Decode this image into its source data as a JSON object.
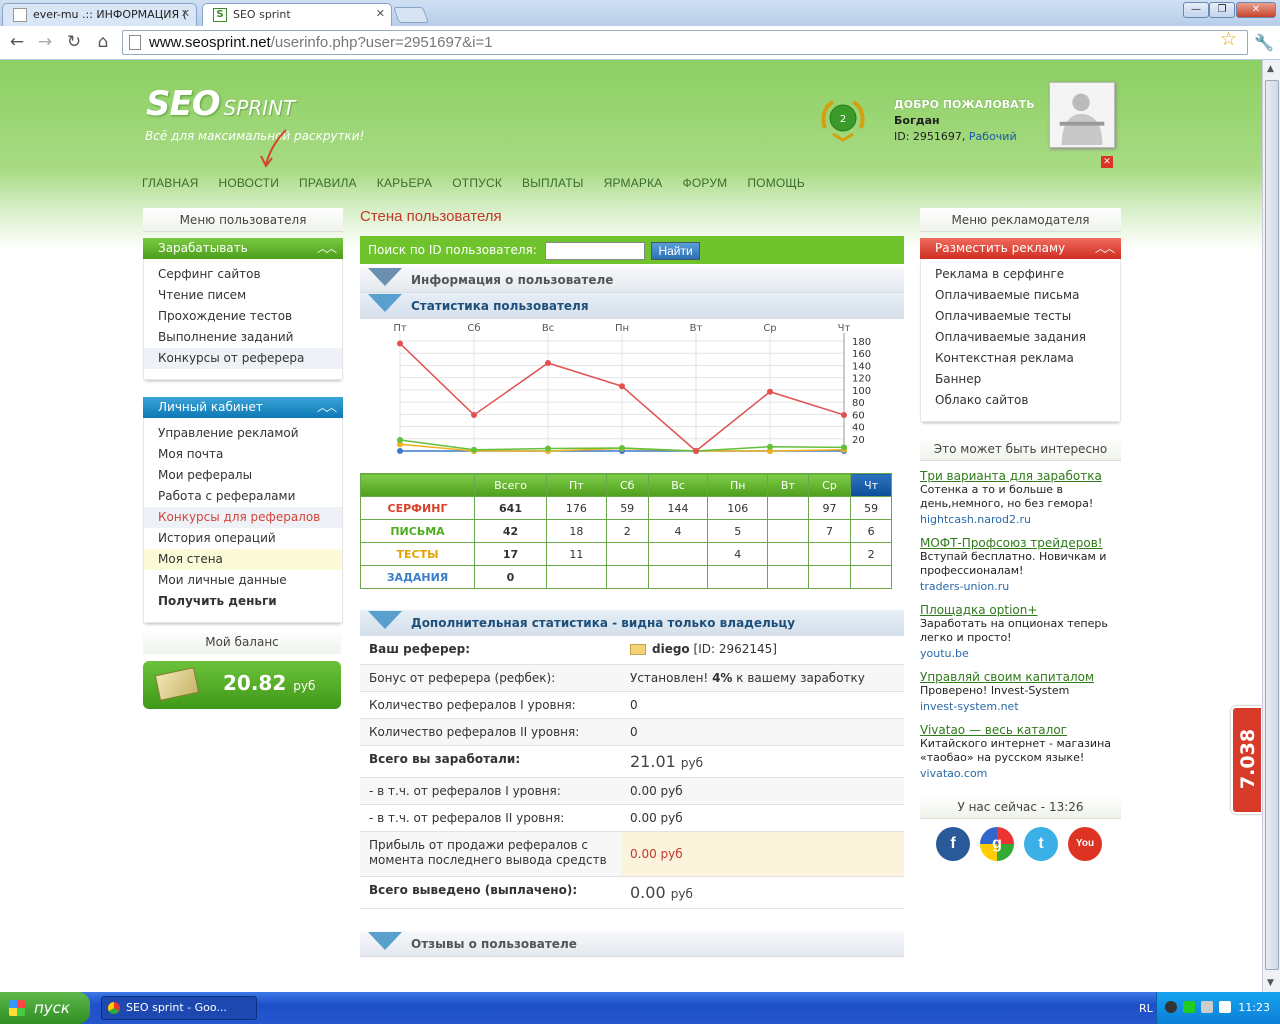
{
  "browser": {
    "tabs": [
      {
        "label": "ever-mu .:: ИНФОРМАЦИЯ ("
      },
      {
        "label": "SEO sprint"
      }
    ],
    "url_host": "www.seosprint.net",
    "url_path": "/userinfo.php?user=2951697&i=1",
    "window_buttons": {
      "minimize": "—",
      "maximize": "❐",
      "close": "✕"
    }
  },
  "header": {
    "logo_main": "SEO",
    "logo_sub": "SPRINT",
    "tagline": "Всё для максимальной раскрутки!",
    "medal_level": "2",
    "welcome_heading": "ДОБРО ПОЖАЛОВАТЬ",
    "user_name": "Богдан",
    "user_id_prefix": "ID: 2951697,",
    "user_status": "Рабочий",
    "logout_glyph": "✕"
  },
  "topnav": [
    "ГЛАВНАЯ",
    "НОВОСТИ",
    "ПРАВИЛА",
    "КАРЬЕРА",
    "ОТПУСК",
    "ВЫПЛАТЫ",
    "ЯРМАРКА",
    "ФОРУМ",
    "ПОМОЩЬ"
  ],
  "left": {
    "user_menu_title": "Меню пользователя",
    "earn": {
      "title": "Зарабатывать",
      "items": [
        "Серфинг сайтов",
        "Чтение писем",
        "Прохождение тестов",
        "Выполнение заданий",
        "Конкурсы от реферера"
      ]
    },
    "cabinet": {
      "title": "Личный кабинет",
      "items": [
        "Управление рекламой",
        "Моя почта",
        "Мои рефералы",
        "Работа с рефералами",
        "Конкурсы для рефералов",
        "История операций",
        "Моя стена",
        "Мои личные данные",
        "Получить деньги"
      ]
    },
    "balance": {
      "title": "Мой баланс",
      "amount": "20.82",
      "currency": "руб"
    }
  },
  "center": {
    "page_title": "Стена пользователя",
    "search_label": "Поиск по ID пользователя:",
    "search_value": "",
    "search_button": "Найти",
    "sect_info": "Информация о пользователе",
    "sect_stats": "Статистика пользователя",
    "sect_additional": "Дополнительная статистика - видна только владельцу",
    "sect_reviews": "Отзывы о пользователе",
    "stats_table": {
      "headers": [
        "",
        "Всего",
        "Пт",
        "Сб",
        "Вс",
        "Пн",
        "Вт",
        "Ср",
        "Чт"
      ],
      "rows": [
        {
          "label": "СЕРФИНГ",
          "cells": [
            "641",
            "176",
            "59",
            "144",
            "106",
            "",
            "97",
            "59"
          ]
        },
        {
          "label": "ПИСЬМА",
          "cells": [
            "42",
            "18",
            "2",
            "4",
            "5",
            "",
            "7",
            "6"
          ]
        },
        {
          "label": "ТЕСТЫ",
          "cells": [
            "17",
            "11",
            "",
            "",
            "4",
            "",
            "",
            "2"
          ]
        },
        {
          "label": "ЗАДАНИЯ",
          "cells": [
            "0",
            "",
            "",
            "",
            "",
            "",
            "",
            ""
          ]
        }
      ]
    },
    "additional": [
      {
        "k": "Ваш реферер:",
        "v": "diego",
        "v2": "[ID: 2962145]"
      },
      {
        "k": "Бонус от реферера (рефбек):",
        "v": "Установлен!",
        "v2": "4%",
        "v3": "к вашему заработку"
      },
      {
        "k": "Количество рефералов I уровня:",
        "v": "0"
      },
      {
        "k": "Количество рефералов II уровня:",
        "v": "0"
      },
      {
        "k": "Всего вы заработали:",
        "v": "21.01",
        "v2": "руб"
      },
      {
        "k": "- в т.ч. от рефералов I уровня:",
        "v": "0.00 руб"
      },
      {
        "k": "- в т.ч. от рефералов II уровня:",
        "v": "0.00 руб"
      },
      {
        "k": "Прибыль от продажи рефералов с момента последнего вывода средств",
        "v": "0.00 руб"
      },
      {
        "k": "Всего выведено (выплачено):",
        "v": "0.00",
        "v2": "руб"
      }
    ]
  },
  "chart_data": {
    "type": "line",
    "categories": [
      "Пт",
      "Сб",
      "Вс",
      "Пн",
      "Вт",
      "Ср",
      "Чт"
    ],
    "ylim": [
      0,
      180
    ],
    "yticks": [
      "180",
      "160",
      "140",
      "120",
      "100",
      "80",
      "60",
      "40",
      "20"
    ],
    "grid": true,
    "series": [
      {
        "values": [
          176,
          59,
          144,
          106,
          0,
          97,
          59
        ],
        "color": "#e25050"
      },
      {
        "values": [
          18,
          2,
          4,
          5,
          0,
          7,
          6
        ],
        "color": "#62c13a"
      },
      {
        "values": [
          11,
          0,
          0,
          4,
          0,
          0,
          2
        ],
        "color": "#f0b020"
      },
      {
        "values": [
          0,
          0,
          0,
          0,
          0,
          0,
          0
        ],
        "color": "#3a7ac8"
      }
    ]
  },
  "right": {
    "adv_menu_title": "Меню рекламодателя",
    "place_ad": "Разместить рекламу",
    "items": [
      "Реклама в серфинге",
      "Оплачиваемые письма",
      "Оплачиваемые тесты",
      "Оплачиваемые задания",
      "Контекстная реклама",
      "Баннер",
      "Облако сайтов"
    ],
    "interesting_title": "Это может быть интересно",
    "ads": [
      {
        "title": "Три варианта для заработка",
        "desc": "Сотенка а то и больше в день,немного, но без гемора!",
        "url": "hightcash.narod2.ru"
      },
      {
        "title": "МОФТ-Профсоюз трейдеров!",
        "desc": "Вступай бесплатно. Новичкам и профессионалам!",
        "url": "traders-union.ru"
      },
      {
        "title": "Площадка option+",
        "desc": "Заработать на опционах теперь легко и просто!",
        "url": "youtu.be"
      },
      {
        "title": "Управляй своим капиталом",
        "desc": "Проверено! Invest-System",
        "url": "invest-system.net"
      },
      {
        "title": "Vivatao — весь каталог",
        "desc": "Китайского интернет - магазина «таобао» на русском языке!",
        "url": "vivatao.com"
      }
    ],
    "now_title": "У нас сейчас - 13:26",
    "social": [
      "f",
      "g",
      "t",
      "You Tube"
    ]
  },
  "counter": "7.038",
  "taskbar": {
    "start": "пуск",
    "task": "SEO sprint - Goo...",
    "lang": "RL",
    "clock": "11:23"
  },
  "colors": {
    "brand_green": "#6fc42e",
    "accent_red": "#c0392b",
    "link_blue": "#2a6aa8"
  }
}
